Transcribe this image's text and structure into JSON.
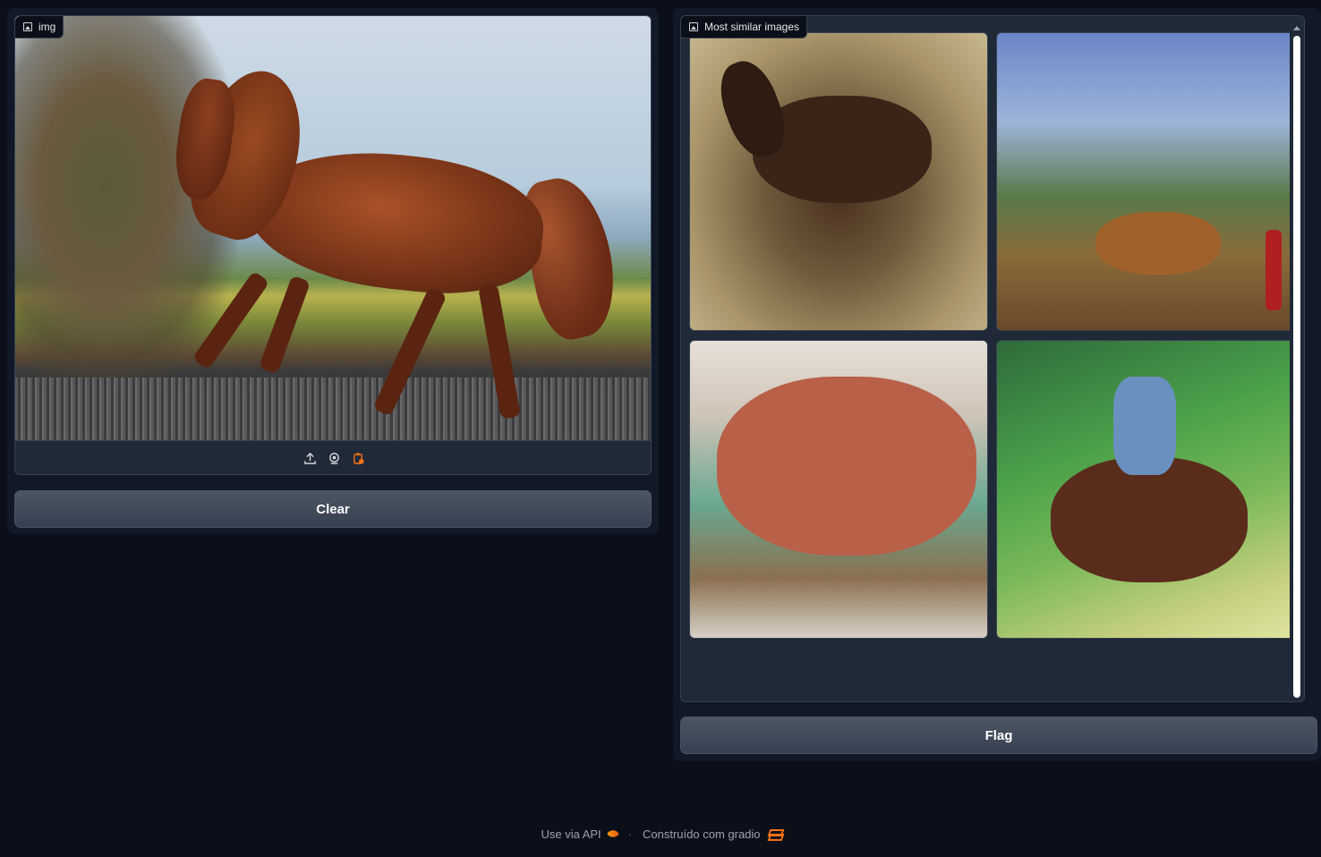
{
  "input_panel": {
    "label": "img",
    "close_symbol": "×",
    "toolbar_icons": [
      "upload-icon",
      "webcam-icon",
      "clipboard-icon"
    ],
    "clear_label": "Clear"
  },
  "output_panel": {
    "label": "Most similar images",
    "flag_label": "Flag"
  },
  "footer": {
    "api_label": "Use via API",
    "separator": "·",
    "built_with": "Construído com gradio"
  },
  "colors": {
    "background": "#0b0f19",
    "panel": "#111827",
    "block": "#1f2937",
    "button": "#374151",
    "accent": "#f97316"
  }
}
